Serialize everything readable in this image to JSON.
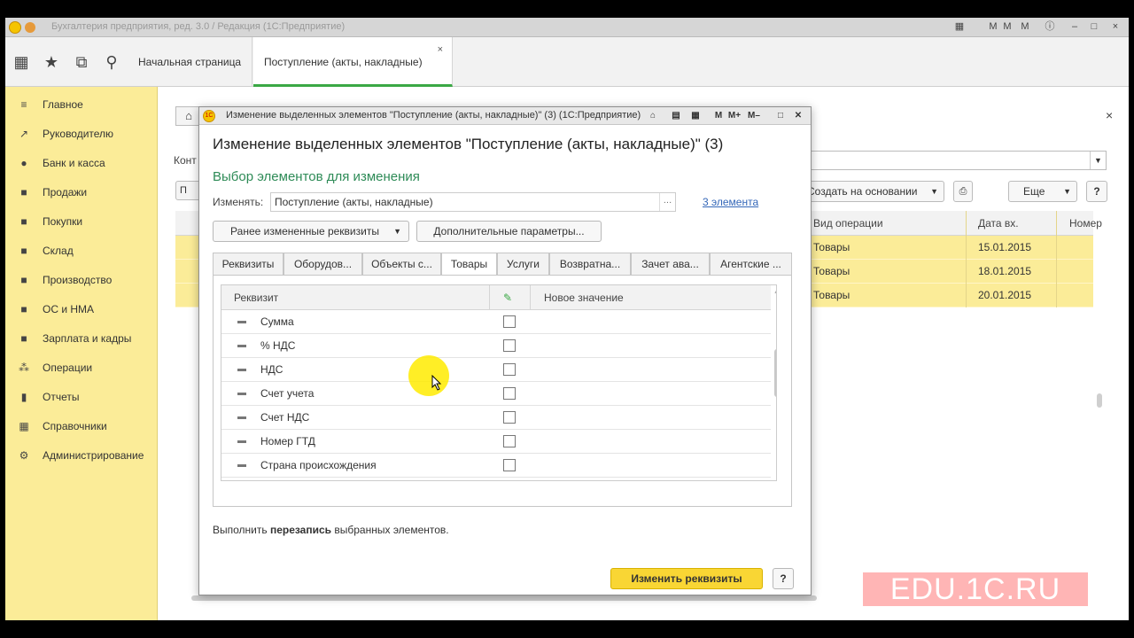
{
  "titlebar": {
    "text": "Бухгалтерия предприятия, ред. 3.0 / Редакция (1С:Предприятие)"
  },
  "toolbar": {
    "icons": [
      "apps-icon",
      "star-icon",
      "history-icon",
      "search-icon"
    ],
    "tabs": [
      {
        "label": "Начальная страница"
      },
      {
        "label": "Поступление (акты, накладные)",
        "close": "×"
      }
    ]
  },
  "sidebar": {
    "items": [
      {
        "label": "Главное",
        "icon": "≡"
      },
      {
        "label": "Руководителю",
        "icon": "↗"
      },
      {
        "label": "Банк и касса",
        "icon": "●"
      },
      {
        "label": "Продажи",
        "icon": "■"
      },
      {
        "label": "Покупки",
        "icon": "■"
      },
      {
        "label": "Склад",
        "icon": "■"
      },
      {
        "label": "Производство",
        "icon": "■"
      },
      {
        "label": "ОС и НМА",
        "icon": "■"
      },
      {
        "label": "Зарплата и кадры",
        "icon": "■"
      },
      {
        "label": "Операции",
        "icon": "⁂"
      },
      {
        "label": "Отчеты",
        "icon": "▮"
      },
      {
        "label": "Справочники",
        "icon": "▦"
      },
      {
        "label": "Администрирование",
        "icon": "⚙"
      }
    ]
  },
  "background": {
    "close": "×",
    "home_icon": "⌂",
    "kont_label": "Конт",
    "left_btn": "П",
    "basis_label": "Создать на основании",
    "more_label": "Еще",
    "help_label": "?",
    "columns": [
      "Вид операции",
      "Дата вх.",
      "Номер"
    ],
    "rows": [
      {
        "op": "Товары",
        "date": "15.01.2015"
      },
      {
        "op": "Товары",
        "date": "18.01.2015"
      },
      {
        "op": "Товары",
        "date": "20.01.2015"
      }
    ]
  },
  "modal": {
    "window_title": "Изменение выделенных элементов \"Поступление (акты, накладные)\" (3) (1С:Предприятие)",
    "heading": "Изменение выделенных элементов \"Поступление (акты, накладные)\" (3)",
    "subheading": "Выбор элементов для изменения",
    "change_label": "Изменять:",
    "change_value": "Поступление (акты, накладные)",
    "elements_link": "3 элемента",
    "prev_changed_btn": "Ранее измененные реквизиты",
    "extra_params_btn": "Дополнительные параметры...",
    "tabs": [
      {
        "label": "Реквизиты"
      },
      {
        "label": "Оборудов..."
      },
      {
        "label": "Объекты с..."
      },
      {
        "label": "Товары"
      },
      {
        "label": "Услуги"
      },
      {
        "label": "Возвратна..."
      },
      {
        "label": "Зачет ава..."
      },
      {
        "label": "Агентские ..."
      }
    ],
    "active_tab": 3,
    "grid": {
      "columns": [
        "Реквизит",
        "",
        "Новое значение"
      ],
      "rows": [
        {
          "name": "Сумма"
        },
        {
          "name": "% НДС"
        },
        {
          "name": "НДС"
        },
        {
          "name": "Счет учета"
        },
        {
          "name": "Счет НДС"
        },
        {
          "name": "Номер ГТД"
        },
        {
          "name": "Страна происхождения"
        }
      ]
    },
    "footer_prefix": "Выполнить ",
    "footer_bold": "перезапись",
    "footer_suffix": " выбранных элементов.",
    "primary_btn": "Изменить реквизиты",
    "help_btn": "?"
  },
  "watermark": "EDU.1C.RU",
  "colors": {
    "sidebar_bg": "#fbec98",
    "accent_green": "#3aa845",
    "primary_yellow": "#f9d634",
    "link_blue": "#3467b8"
  }
}
